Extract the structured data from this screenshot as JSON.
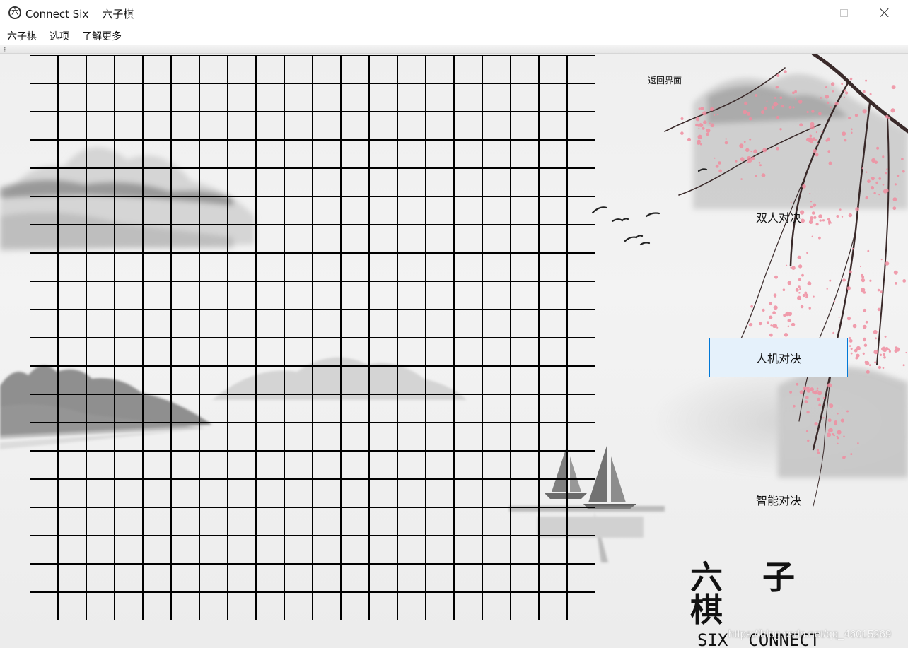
{
  "window": {
    "title": "Connect Six    六子棋",
    "app_icon": "six-badge-icon",
    "controls": [
      "minimize-icon",
      "maximize-icon",
      "close-icon"
    ]
  },
  "menu": {
    "items": [
      "六子棋",
      "选项",
      "了解更多"
    ]
  },
  "board": {
    "rows": 20,
    "cols": 20,
    "line_color": "#000000"
  },
  "side_panel": {
    "back_label": "返回界面",
    "buttons": [
      {
        "label": "双人对决",
        "active": false
      },
      {
        "label": "人机对决",
        "active": true
      },
      {
        "label": "智能对决",
        "active": false
      }
    ]
  },
  "logo": {
    "cn": "六 子 棋",
    "en": "SIX  CONNECT"
  },
  "watermark": "https://blog.csdn.net/qq_46015269",
  "colors": {
    "active_button_bg": "#e5f1fb",
    "active_button_border": "#0078d7",
    "blossom": "#f08ea0",
    "branch": "#3a2a2a",
    "ink_mountain": "#9a9a9a"
  }
}
